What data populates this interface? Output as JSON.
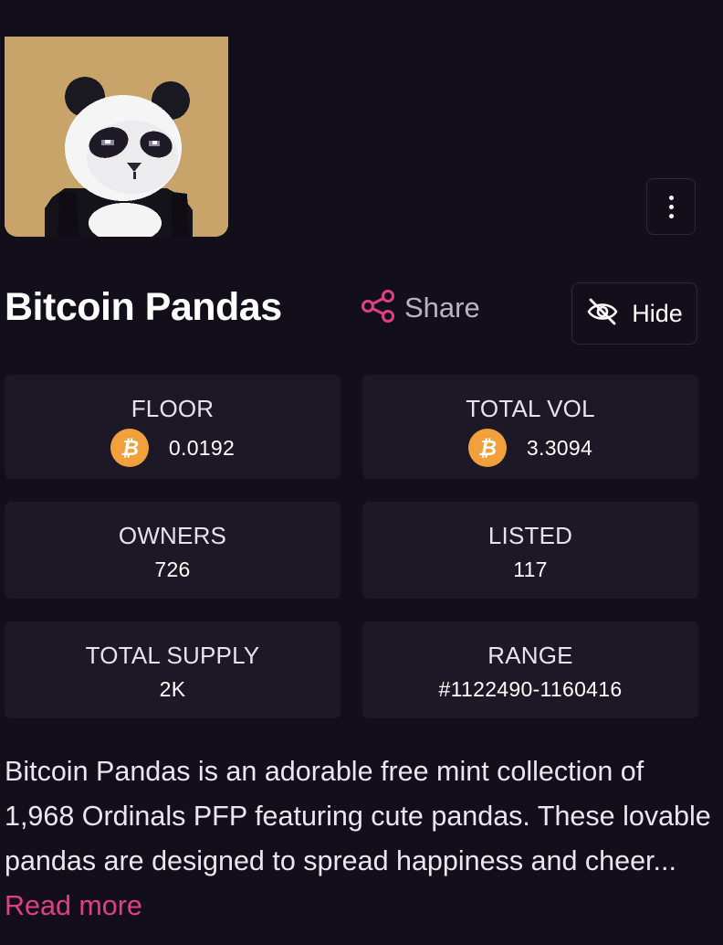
{
  "collection": {
    "name": "Bitcoin Pandas",
    "share_label": "Share",
    "hide_label": "Hide"
  },
  "stats": {
    "floor": {
      "label": "FLOOR",
      "value": "0.0192",
      "currency_icon": "bitcoin-icon"
    },
    "total_vol": {
      "label": "TOTAL VOL",
      "value": "3.3094",
      "currency_icon": "bitcoin-icon"
    },
    "owners": {
      "label": "OWNERS",
      "value": "726"
    },
    "listed": {
      "label": "LISTED",
      "value": "117"
    },
    "total_supply": {
      "label": "TOTAL SUPPLY",
      "value": "2K"
    },
    "range": {
      "label": "RANGE",
      "value": "#1122490-1160416"
    }
  },
  "description": {
    "text": "Bitcoin Pandas is an adorable free mint collection of 1,968 Ordinals PFP featuring cute pandas. These lovable pandas are designed to spread happiness and cheer...",
    "read_more": "Read more"
  },
  "icons": {
    "more": "vertical-dots-icon",
    "share": "share-icon",
    "hide": "eye-off-icon",
    "currency": "bitcoin-icon"
  },
  "colors": {
    "background": "#130f1a",
    "card": "#1c1826",
    "accent": "#e0407f",
    "bitcoin": "#f2a03b",
    "avatar_background": "#c9a46a"
  }
}
